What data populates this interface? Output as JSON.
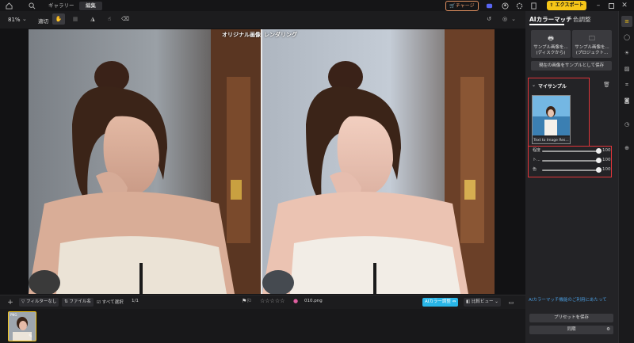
{
  "titlebar": {
    "tabs": [
      "ギャラリー",
      "編集"
    ],
    "charge_label": "チャージ",
    "export_label": "エクスポート"
  },
  "toolbar": {
    "zoom": "81%",
    "fit_label": "適切"
  },
  "canvas": {
    "original_label": "オリジナル画像",
    "rendered_label": "レンダリング"
  },
  "bottombar": {
    "filter_label": "フィルターなし",
    "filename_label": "ファイル名",
    "select_all_label": "すべて選択",
    "count": "1/1",
    "file_name": "010.png",
    "ai_match_badge": "AIカラー調整",
    "compare_view_label": "比較ビュー"
  },
  "panel": {
    "tabs": [
      "AIカラーマッチ",
      "色調整"
    ],
    "sample_disk_label": "サンプル画像を... (ディスクから)",
    "sample_project_label": "サンプル画像を... (プロジェクト...",
    "save_current_label": "現在の画像をサンプルとして保存",
    "my_samples_label": "マイサンプル",
    "sample_caption": "Text to Image Res...",
    "sliders": [
      {
        "label": "程度",
        "value": 100
      },
      {
        "label": "ト...",
        "value": 100
      },
      {
        "label": "色",
        "value": 100
      }
    ],
    "help_link": "AIカラーマッチ機能のご利用にあたって",
    "save_preset_label": "プリセットを保存",
    "sync_label": "同期"
  },
  "icons": {
    "accent_color": "#f5c518",
    "link_color": "#4a9de0",
    "badge_color": "#29b6e8"
  }
}
